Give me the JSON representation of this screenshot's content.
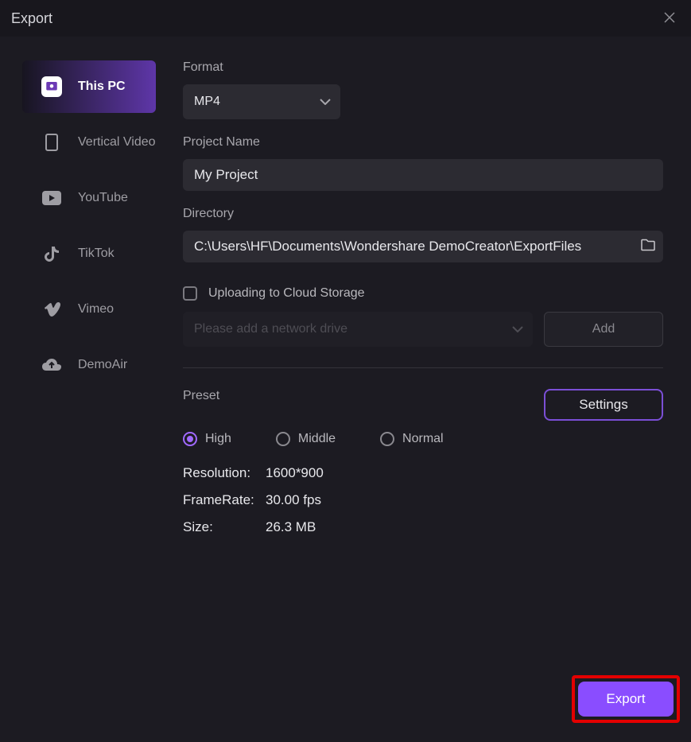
{
  "titlebar": {
    "title": "Export"
  },
  "sidebar": {
    "items": [
      {
        "label": "This PC"
      },
      {
        "label": "Vertical Video"
      },
      {
        "label": "YouTube"
      },
      {
        "label": "TikTok"
      },
      {
        "label": "Vimeo"
      },
      {
        "label": "DemoAir"
      }
    ]
  },
  "form": {
    "format_label": "Format",
    "format_value": "MP4",
    "project_label": "Project Name",
    "project_value": "My Project",
    "directory_label": "Directory",
    "directory_value": "C:\\Users\\HF\\Documents\\Wondershare DemoCreator\\ExportFiles",
    "cloud_checkbox_label": "Uploading to Cloud Storage",
    "cloud_placeholder": "Please add a network drive",
    "add_button": "Add"
  },
  "preset": {
    "label": "Preset",
    "settings_button": "Settings",
    "options": [
      {
        "label": "High"
      },
      {
        "label": "Middle"
      },
      {
        "label": "Normal"
      }
    ],
    "specs": {
      "resolution_k": "Resolution:",
      "resolution_v": "1600*900",
      "framerate_k": "FrameRate:",
      "framerate_v": "30.00 fps",
      "size_k": "Size:",
      "size_v": "26.3 MB"
    }
  },
  "footer": {
    "export_button": "Export"
  }
}
